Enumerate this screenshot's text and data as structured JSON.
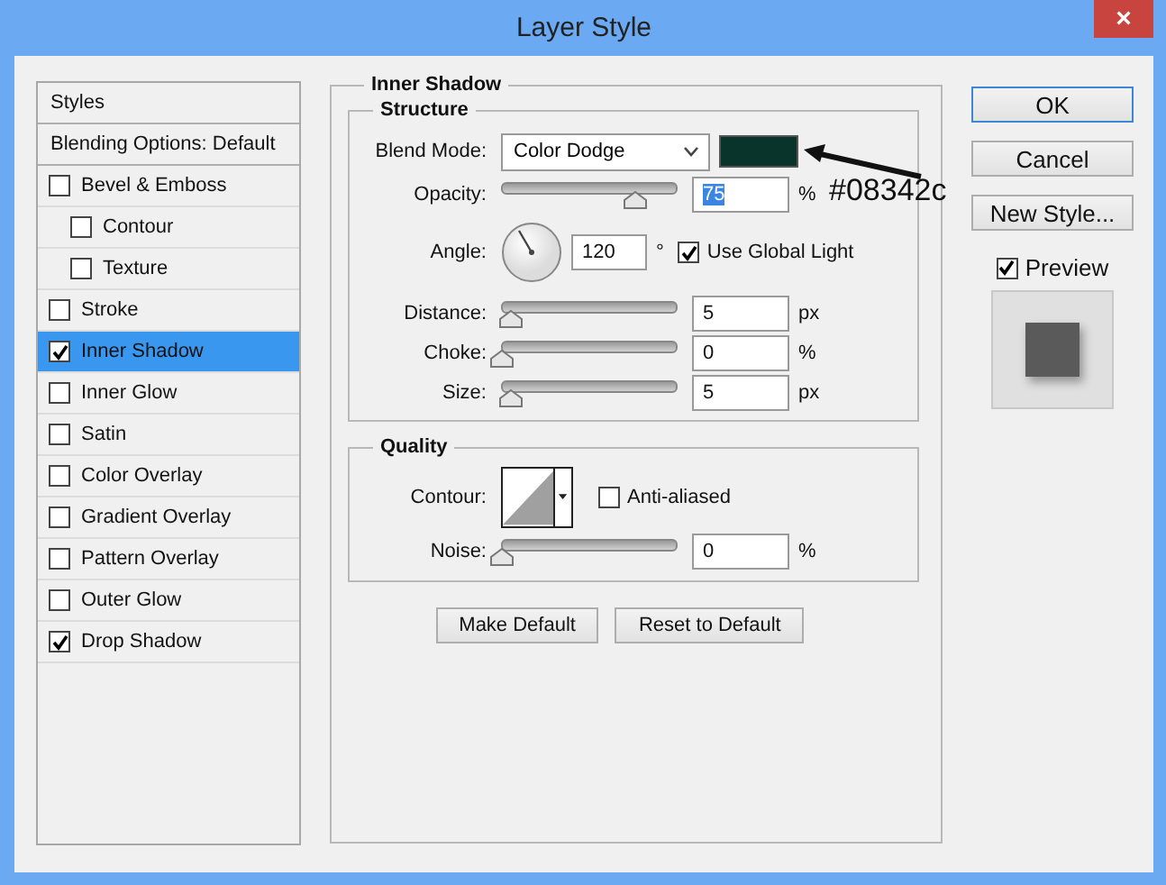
{
  "window": {
    "title": "Layer Style",
    "close": "×"
  },
  "sidebar": {
    "header": "Styles",
    "blending": "Blending Options: Default",
    "items": [
      {
        "label": "Bevel & Emboss",
        "checked": false,
        "selected": false,
        "children": [
          {
            "label": "Contour",
            "checked": false,
            "selected": false
          },
          {
            "label": "Texture",
            "checked": false,
            "selected": false
          }
        ]
      },
      {
        "label": "Stroke",
        "checked": false,
        "selected": false
      },
      {
        "label": "Inner Shadow",
        "checked": true,
        "selected": true
      },
      {
        "label": "Inner Glow",
        "checked": false,
        "selected": false
      },
      {
        "label": "Satin",
        "checked": false,
        "selected": false
      },
      {
        "label": "Color Overlay",
        "checked": false,
        "selected": false
      },
      {
        "label": "Gradient Overlay",
        "checked": false,
        "selected": false
      },
      {
        "label": "Pattern Overlay",
        "checked": false,
        "selected": false
      },
      {
        "label": "Outer Glow",
        "checked": false,
        "selected": false
      },
      {
        "label": "Drop Shadow",
        "checked": true,
        "selected": false
      }
    ]
  },
  "panel": {
    "title": "Inner Shadow",
    "structure": {
      "title": "Structure",
      "blend_mode": {
        "label": "Blend Mode:",
        "value": "Color Dodge",
        "color": "#08342c"
      },
      "rows": [
        {
          "kind": "slider",
          "label": "Opacity:",
          "value": "75",
          "unit": "%",
          "level": 0.75,
          "highlighted": true
        },
        {
          "kind": "angle",
          "label": "Angle:",
          "value": "120",
          "unit": "°",
          "global_light": {
            "label": "Use Global Light",
            "checked": true
          }
        },
        {
          "kind": "slider",
          "label": "Distance:",
          "value": "5",
          "unit": "px",
          "level": 0.05,
          "highlighted": false
        },
        {
          "kind": "slider",
          "label": "Choke:",
          "value": "0",
          "unit": "%",
          "level": 0,
          "highlighted": false
        },
        {
          "kind": "slider",
          "label": "Size:",
          "value": "5",
          "unit": "px",
          "level": 0.05,
          "highlighted": false
        }
      ]
    },
    "quality": {
      "title": "Quality",
      "contour": {
        "label": "Contour:"
      },
      "anti_aliased": {
        "label": "Anti-aliased",
        "checked": false
      },
      "noise": {
        "label": "Noise:",
        "value": "0",
        "unit": "%",
        "level": 0
      }
    },
    "buttons": [
      "Make Default",
      "Reset to Default"
    ],
    "annotation": {
      "text": "#08342c"
    }
  },
  "actions": [
    {
      "label": "OK",
      "default": true
    },
    {
      "label": "Cancel",
      "default": false
    },
    {
      "label": "New Style...",
      "default": false
    }
  ],
  "preview": {
    "label": "Preview",
    "checked": true
  }
}
